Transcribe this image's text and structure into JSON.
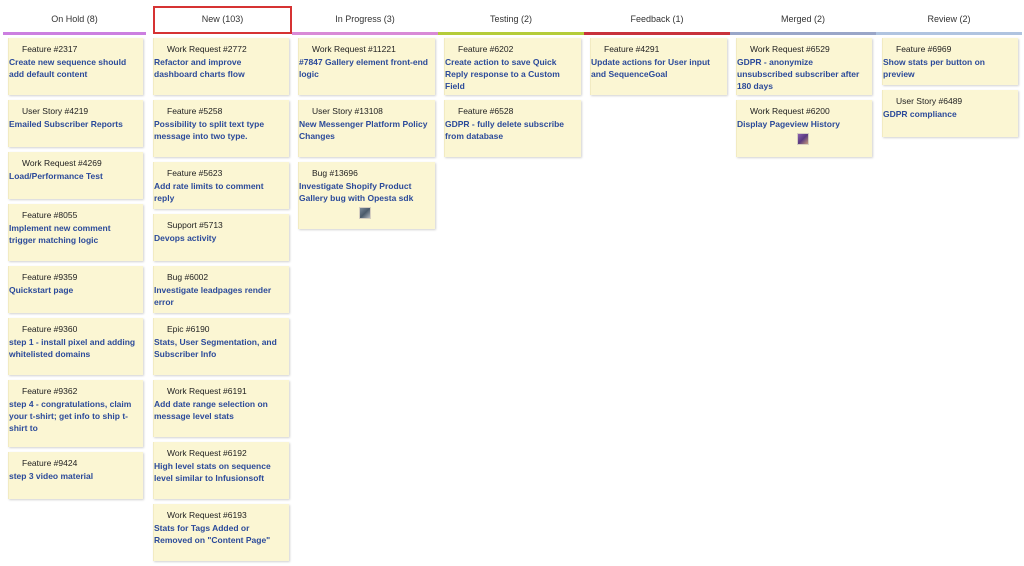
{
  "columns": [
    {
      "key": "onhold",
      "label": "On Hold (8)",
      "color": "#cc7fe0",
      "cards": [
        {
          "type": "Feature #2317",
          "title": "Create new sequence should add default content"
        },
        {
          "type": "User Story #4219",
          "title": "Emailed Subscriber Reports"
        },
        {
          "type": "Work Request #4269",
          "title": "Load/Performance Test"
        },
        {
          "type": "Feature #8055",
          "title": "Implement new comment trigger matching logic"
        },
        {
          "type": "Feature #9359",
          "title": "Quickstart page"
        },
        {
          "type": "Feature #9360",
          "title": "step 1 - install pixel and adding whitelisted domains"
        },
        {
          "type": "Feature #9362",
          "title": "step 4 - congratulations, claim your t-shirt; get info to ship t-shirt to"
        },
        {
          "type": "Feature #9424",
          "title": "step 3 video material"
        }
      ]
    },
    {
      "key": "new",
      "label": "New (103)",
      "color": "#d63333",
      "selected": true,
      "cards": [
        {
          "type": "Work Request #2772",
          "title": "Refactor and improve dashboard charts flow"
        },
        {
          "type": "Feature #5258",
          "title": "Possibility to split text type message into two type."
        },
        {
          "type": "Feature #5623",
          "title": "Add rate limits to comment reply"
        },
        {
          "type": "Support #5713",
          "title": "Devops activity"
        },
        {
          "type": "Bug #6002",
          "title": "Investigate leadpages render error"
        },
        {
          "type": "Epic #6190",
          "title": "Stats, User Segmentation, and Subscriber Info"
        },
        {
          "type": "Work Request #6191",
          "title": "Add date range selection on message level stats"
        },
        {
          "type": "Work Request #6192",
          "title": "High level stats on sequence level similar to Infusionsoft"
        },
        {
          "type": "Work Request #6193",
          "title": "Stats for Tags Added or Removed on \"Content Page\""
        }
      ]
    },
    {
      "key": "inprogress",
      "label": "In Progress (3)",
      "color": "#d98ad6",
      "cards": [
        {
          "type": "Work Request #11221",
          "title": "#7847 Gallery element front-end logic"
        },
        {
          "type": "User Story #13108",
          "title": "New Messenger Platform Policy Changes"
        },
        {
          "type": "Bug #13696",
          "title": "Investigate Shopify Product Gallery bug with Opesta sdk",
          "avatar": "gray"
        }
      ]
    },
    {
      "key": "testing",
      "label": "Testing (2)",
      "color": "#b5cc3a",
      "cards": [
        {
          "type": "Feature #6202",
          "title": "Create action to save Quick Reply response to a Custom Field"
        },
        {
          "type": "Feature #6528",
          "title": "GDPR - fully delete subscribe from database"
        }
      ]
    },
    {
      "key": "feedback",
      "label": "Feedback (1)",
      "color": "#c8323c",
      "cards": [
        {
          "type": "Feature #4291",
          "title": "Update actions for User input and SequenceGoal"
        }
      ]
    },
    {
      "key": "merged",
      "label": "Merged (2)",
      "color": "#9aa6c8",
      "cards": [
        {
          "type": "Work Request #6529",
          "title": "GDPR - anonymize unsubscribed subscriber after 180 days"
        },
        {
          "type": "Work Request #6200",
          "title": "Display Pageview History",
          "avatar": "purple"
        }
      ]
    },
    {
      "key": "review",
      "label": "Review (2)",
      "color": "#b0c4e0",
      "cards": [
        {
          "type": "Feature #6969",
          "title": "Show stats per button on preview"
        },
        {
          "type": "User Story #6489",
          "title": "GDPR compliance"
        }
      ]
    }
  ]
}
